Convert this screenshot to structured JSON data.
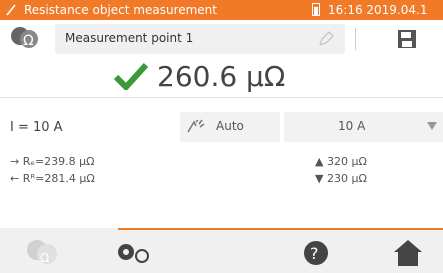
{
  "status": {
    "title": "Resistance object measurement",
    "time": "16:16 2019.04.1"
  },
  "row2": {
    "point_label": "Measurement point 1"
  },
  "result": {
    "value": "260.6 µΩ"
  },
  "settings": {
    "current": "I = 10 A",
    "mode": "Auto",
    "range": "10 A"
  },
  "details": {
    "rf": "→ Rₑ=239.8 µΩ",
    "rr": "← Rᴿ=281.4 µΩ",
    "upper": "320 µΩ",
    "lower": "230 µΩ"
  }
}
